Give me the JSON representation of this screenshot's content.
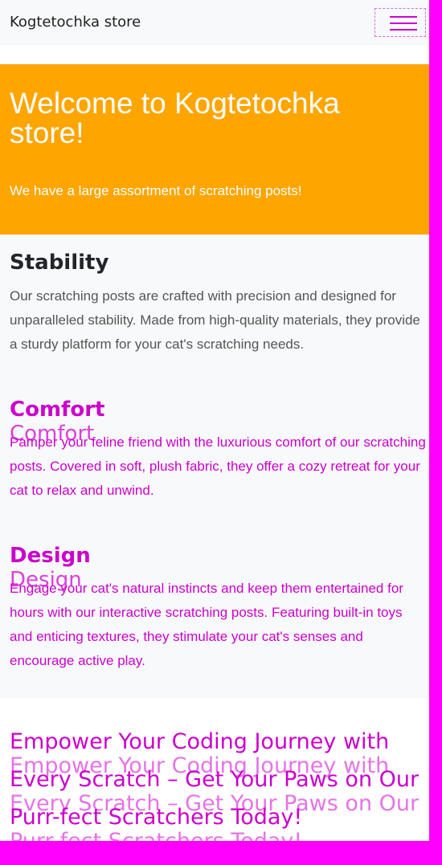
{
  "navbar": {
    "brand": "Kogtetochka store",
    "toggler_icon": "hamburger-icon"
  },
  "hero": {
    "title": "Welcome to Kogtetochka store!",
    "subtitle": "We have a large assortment of scratching posts!"
  },
  "features": [
    {
      "title": "Stability",
      "text": "Our scratching posts are crafted with precision and designed for unparalleled stability. Made from high-quality materials, they provide a sturdy platform for your cat's scratching needs."
    },
    {
      "title": "Comfort",
      "text": "Pamper your feline friend with the luxurious comfort of our scratching posts. Covered in soft, plush fabric, they offer a cozy retreat for your cat to relax and unwind."
    },
    {
      "title": "Design",
      "text": "Engage your cat's natural instincts and keep them entertained for hours with our interactive scratching posts. Featuring built-in toys and enticing textures, they stimulate your cat's senses and encourage active play."
    }
  ],
  "cta": {
    "text": "Empower Your Coding Journey with Every Scratch – Get Your Paws on Our Purr-fect Scratchers Today!"
  },
  "colors": {
    "hero_bg": "#ffa500",
    "page_bg": "#f8f9fa",
    "glitch": "#ff00ff"
  }
}
